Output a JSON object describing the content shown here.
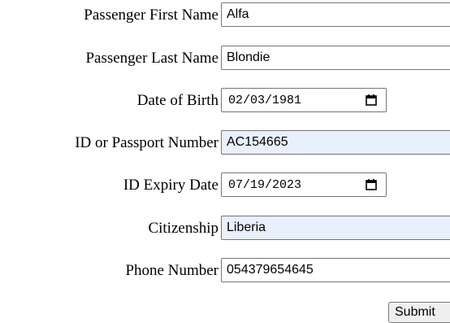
{
  "form": {
    "fields": [
      {
        "label": "Passenger First Name",
        "value": "Alfa",
        "type": "text",
        "autofilled": false
      },
      {
        "label": "Passenger Last Name",
        "value": "Blondie",
        "type": "text",
        "autofilled": false
      },
      {
        "label": "Date of Birth",
        "value": "02/03/1981",
        "type": "date",
        "autofilled": false
      },
      {
        "label": "ID or Passport Number",
        "value": "AC154665",
        "type": "text",
        "autofilled": true
      },
      {
        "label": "ID Expiry Date",
        "value": "07/19/2023",
        "type": "date",
        "autofilled": false
      },
      {
        "label": "Citizenship",
        "value": "Liberia",
        "type": "text",
        "autofilled": true
      },
      {
        "label": "Phone Number",
        "value": "054379654645",
        "type": "text",
        "autofilled": false
      }
    ],
    "submit_label": "Submit",
    "icons": {
      "date_picker": "calendar-icon"
    },
    "colors": {
      "autofill_background": "#e8f0fe",
      "border": "#767676",
      "button_background": "#efefef"
    }
  }
}
